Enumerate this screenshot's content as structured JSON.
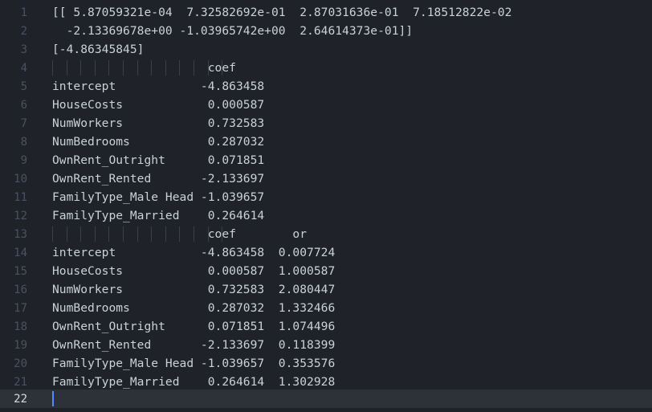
{
  "editor": {
    "lines": [
      {
        "num": "1",
        "text": "[[ 5.87059321e-04  7.32582692e-01  2.87031636e-01  7.18512822e-02"
      },
      {
        "num": "2",
        "text": "  -2.13369678e+00 -1.03965742e+00  2.64614373e-01]]"
      },
      {
        "num": "3",
        "text": "[-4.86345845]"
      },
      {
        "num": "4",
        "text": "                      coef"
      },
      {
        "num": "5",
        "text": "intercept            -4.863458"
      },
      {
        "num": "6",
        "text": "HouseCosts            0.000587"
      },
      {
        "num": "7",
        "text": "NumWorkers            0.732583"
      },
      {
        "num": "8",
        "text": "NumBedrooms           0.287032"
      },
      {
        "num": "9",
        "text": "OwnRent_Outright      0.071851"
      },
      {
        "num": "10",
        "text": "OwnRent_Rented       -2.133697"
      },
      {
        "num": "11",
        "text": "FamilyType_Male Head -1.039657"
      },
      {
        "num": "12",
        "text": "FamilyType_Married    0.264614"
      },
      {
        "num": "13",
        "text": "                      coef        or"
      },
      {
        "num": "14",
        "text": "intercept            -4.863458  0.007724"
      },
      {
        "num": "15",
        "text": "HouseCosts            0.000587  1.000587"
      },
      {
        "num": "16",
        "text": "NumWorkers            0.732583  2.080447"
      },
      {
        "num": "17",
        "text": "NumBedrooms           0.287032  1.332466"
      },
      {
        "num": "18",
        "text": "OwnRent_Outright      0.071851  1.074496"
      },
      {
        "num": "19",
        "text": "OwnRent_Rented       -2.133697  0.118399"
      },
      {
        "num": "20",
        "text": "FamilyType_Male Head -1.039657  0.353576"
      },
      {
        "num": "21",
        "text": "FamilyType_Married    0.264614  1.302928"
      },
      {
        "num": "22",
        "text": ""
      }
    ],
    "active_line": "22"
  },
  "colors": {
    "background": "#1f2329",
    "active_line": "#2c313a",
    "text": "#c9d1d9",
    "line_number": "#495162",
    "cursor": "#528bff"
  }
}
